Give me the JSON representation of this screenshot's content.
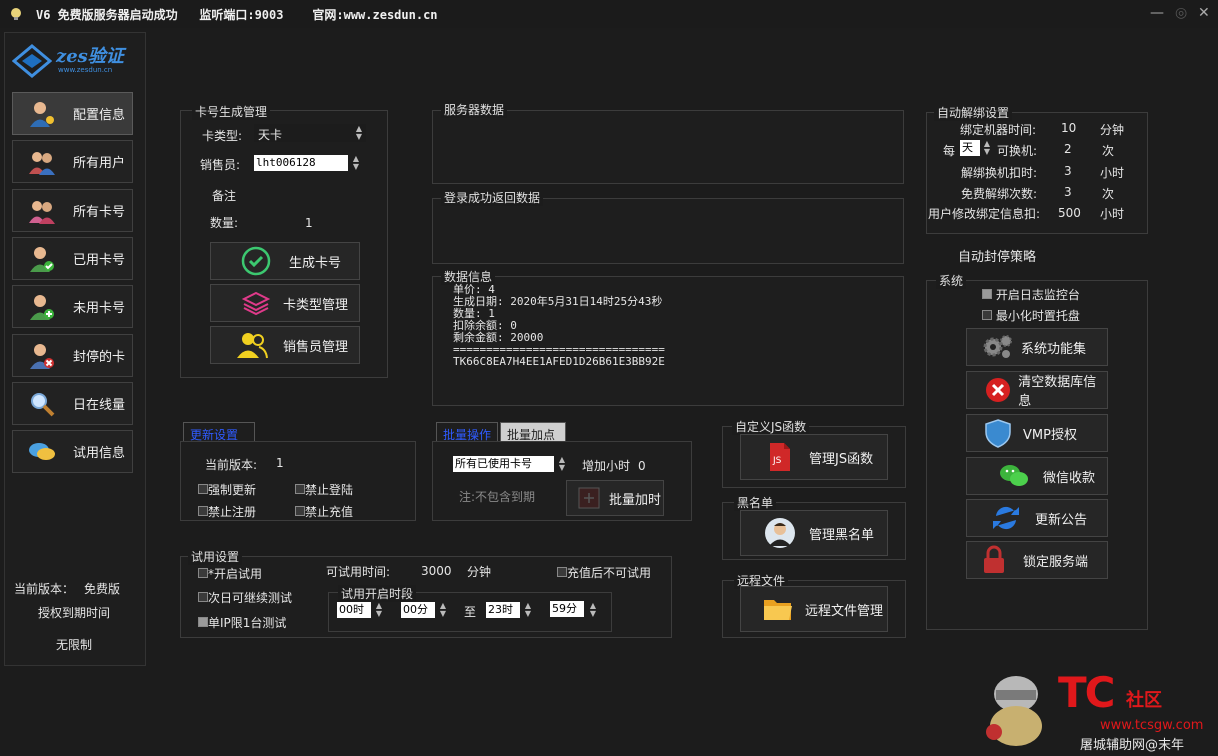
{
  "titlebar": {
    "text": "V6 免费版服务器启动成功   监听端口:9003    官网:www.zesdun.cn",
    "close": "✕",
    "min": "—",
    "restore": "◎"
  },
  "logo": {
    "text": "zes验证",
    "sub": "www.zesdun.cn"
  },
  "nav": [
    {
      "label": "配置信息"
    },
    {
      "label": "所有用户"
    },
    {
      "label": "所有卡号"
    },
    {
      "label": "已用卡号"
    },
    {
      "label": "未用卡号"
    },
    {
      "label": "封停的卡"
    },
    {
      "label": "日在线量"
    },
    {
      "label": "试用信息"
    }
  ],
  "sidebar_footer": {
    "version_label": "当前版本：",
    "version_value": "免费版",
    "expiry_label": "授权到期时间",
    "expiry_value": "无限制"
  },
  "card_gen": {
    "title": "卡号生成管理",
    "type_label": "卡类型:",
    "type_value": "天卡",
    "seller_label": "销售员:",
    "seller_value": "lht006128",
    "note_label": "备注",
    "qty_label": "数量:",
    "qty_value": "1",
    "btn_generate": "生成卡号",
    "btn_type_manage": "卡类型管理",
    "btn_seller_manage": "销售员管理"
  },
  "server_data": {
    "title": "服务器数据"
  },
  "login_return": {
    "title": "登录成功返回数据"
  },
  "data_info": {
    "title": "数据信息",
    "lines": [
      "单价: 4",
      "生成日期: 2020年5月31日14时25分43秒",
      "数量: 1",
      "扣除余额: 0",
      "剩余金额: 20000",
      "================================",
      "TK66C8EA7H4EE1AFED1D26B61E3BB92E"
    ]
  },
  "auto_unbind": {
    "title": "自动解绑设置",
    "rows": [
      {
        "label": "绑定机器时间:",
        "value": "10",
        "unit": "分钟"
      },
      {
        "label": "可换机:",
        "value": "2",
        "unit": "次"
      },
      {
        "label": "解绑换机扣时:",
        "value": "3",
        "unit": "小时"
      },
      {
        "label": "免费解绑次数:",
        "value": "3",
        "unit": "次"
      },
      {
        "label": "用户修改绑定信息扣:",
        "value": "500",
        "unit": "小时"
      }
    ],
    "per_label": "每",
    "per_value": "天"
  },
  "auto_ban": {
    "title": "自动封停策略"
  },
  "system": {
    "title": "系统",
    "chk_log": "开启日志监控台",
    "chk_tray": "最小化时置托盘",
    "buttons": [
      "系统功能集",
      "清空数据库信息",
      "VMP授权",
      "微信收款",
      "更新公告",
      "锁定服务端"
    ]
  },
  "update_panel": {
    "tab": "更新设置",
    "version_label": "当前版本:",
    "version_value": "1",
    "chk_force": "强制更新",
    "chk_nologin": "禁止登陆",
    "chk_noreg": "禁止注册",
    "chk_norecharge": "禁止充值"
  },
  "batch_panel": {
    "tab_active": "批量操作",
    "tab_inactive": "批量加点",
    "select_value": "所有已使用卡号",
    "hours_label": "增加小时",
    "hours_value": "0",
    "note": "注:不包含到期",
    "btn": "批量加时"
  },
  "js_func": {
    "title": "自定义JS函数",
    "btn": "管理JS函数"
  },
  "blacklist": {
    "title": "黑名单",
    "btn": "管理黑名单"
  },
  "remote_file": {
    "title": "远程文件",
    "btn": "远程文件管理"
  },
  "trial": {
    "title": "试用设置",
    "chk_enable": "*开启试用",
    "time_label": "可试用时间:",
    "time_value": "3000",
    "time_unit": "分钟",
    "chk_no_after_recharge": "充值后不可试用",
    "chk_next_day": "次日可继续测试",
    "chk_single_ip": "单IP限1台测试",
    "period_title": "试用开启时段",
    "start_h": "00时",
    "start_m": "00分",
    "to": "至",
    "end_h": "23时",
    "end_m": "59分"
  },
  "watermark": {
    "brand": "TC",
    "brand2": "社区",
    "url": "www.tcsgw.com",
    "credit": "屠城辅助网@末年"
  },
  "colors": {
    "accent_blue": "#2f5bff",
    "bg": "#1c1c1c",
    "watermark_red": "#e0181b"
  }
}
